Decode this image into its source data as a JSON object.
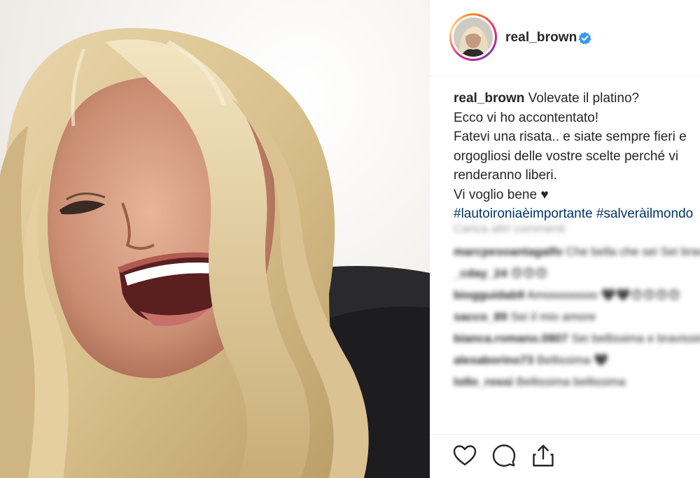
{
  "post": {
    "username": "real_brown",
    "verified": true,
    "caption": {
      "username": "real_brown",
      "lines": [
        "Volevate il platino?",
        "Ecco vi ho accontentato!",
        "Fatevi una risata.. e siate sempre fieri e",
        "orgogliosi delle vostre scelte perché vi",
        "renderanno liberi.",
        "Vi voglio bene"
      ],
      "heart": "♥",
      "hashtags": "#lautoironiaèimportante #salveràilmondo"
    }
  },
  "comments": {
    "load_more": "Carica altri commenti",
    "items": [
      {
        "user": "marcpesoantagalfo",
        "text": "Che bella che sei Sei bravissima! 😍😍😍 ciao Emma"
      },
      {
        "user": "_cday_24",
        "text": "😍😍😍"
      },
      {
        "user": "biogguidab9",
        "text": "Amoooooooo 🖤🖤😍😍😍😍"
      },
      {
        "user": "sacco_89",
        "text": "Sei il mio amore"
      },
      {
        "user": "bianca.romano.0807",
        "text": "Sei bellissima e bravissima🖤"
      },
      {
        "user": "alesaborino73",
        "text": "Bellissima 🖤"
      },
      {
        "user": "lollo_rossi",
        "text": "Bellissima bellissima"
      }
    ]
  },
  "icons": {
    "like": "heart-outline-icon",
    "comment": "speech-bubble-icon",
    "share": "share-upload-icon",
    "verified": "verified-badge-icon"
  },
  "colors": {
    "verified": "#3897f0",
    "hashtag": "#003569",
    "text": "#262626",
    "muted": "#999999"
  }
}
